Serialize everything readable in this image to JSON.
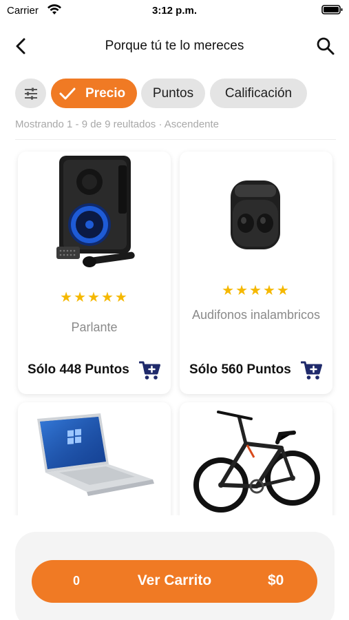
{
  "status_bar": {
    "carrier": "Carrier",
    "time": "3:12 p.m."
  },
  "header": {
    "title": "Porque tú te lo mereces"
  },
  "filters": {
    "active": "Precio",
    "puntos": "Puntos",
    "calificacion": "Calificación"
  },
  "results": {
    "summary": "Mostrando 1 - 9 de 9 reultados · Ascendente"
  },
  "products": [
    {
      "name": "Parlante",
      "price": "Sólo 448 Puntos",
      "rating": "★★★★★",
      "image": "speaker"
    },
    {
      "name": "Audifonos inalambricos",
      "price": "Sólo 560 Puntos",
      "rating": "★★★★★",
      "image": "earbuds"
    },
    {
      "name": "",
      "price": "",
      "rating": "",
      "image": "laptop"
    },
    {
      "name": "",
      "price": "",
      "rating": "",
      "image": "bicycle"
    }
  ],
  "cart": {
    "count": "0",
    "label": "Ver Carrito",
    "total": "$0"
  },
  "colors": {
    "accent": "#f07a24",
    "chip": "#e4e4e4",
    "star": "#f5b800",
    "cart_icon": "#1f2a6b"
  }
}
